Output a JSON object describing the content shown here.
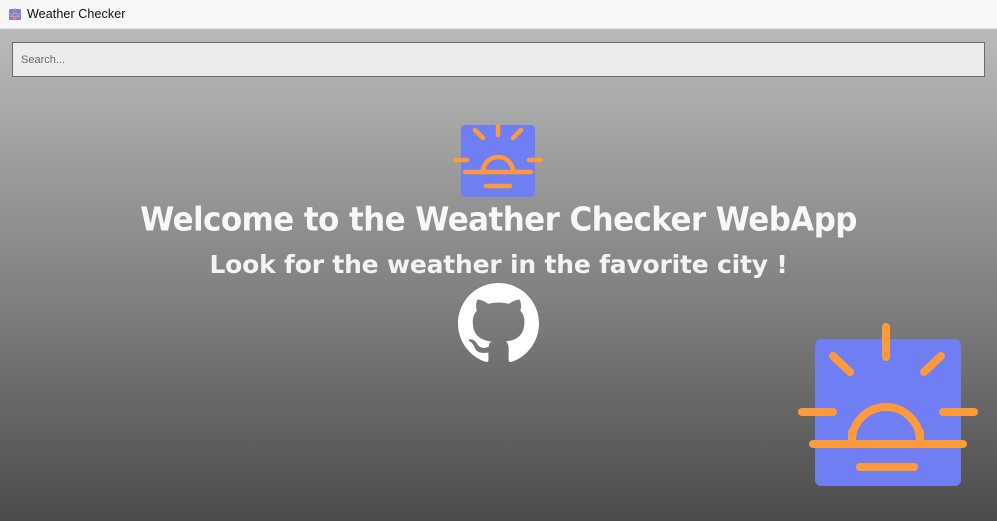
{
  "app": {
    "title": "Weather Checker"
  },
  "search": {
    "placeholder": "Search...",
    "value": ""
  },
  "hero": {
    "title": "Welcome to the Weather Checker WebApp",
    "subtitle": "Look for the weather in the favorite city !"
  },
  "icons": {
    "brand": "sun-logo-icon",
    "hero": "sunrise-icon",
    "github": "github-icon",
    "corner": "sunrise-icon"
  },
  "colors": {
    "icon_bg": "#6f7ff3",
    "icon_sun": "#ff9a3c",
    "text": "#f5f5f5",
    "topbar_bg": "#f7f7f7"
  }
}
